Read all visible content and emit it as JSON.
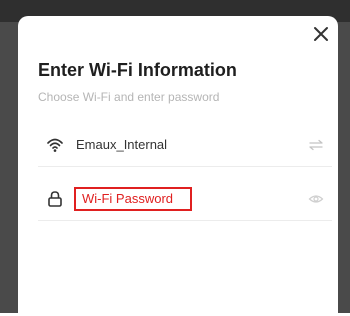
{
  "dialog": {
    "title": "Enter Wi-Fi Information",
    "subtitle": "Choose Wi-Fi and enter password"
  },
  "wifi_row": {
    "icon": "wifi-icon",
    "ssid": "Emaux_Internal",
    "action_icon": "swap-icon"
  },
  "password_row": {
    "icon": "lock-icon",
    "placeholder": "Wi-Fi Password",
    "action_icon": "eye-icon"
  },
  "colors": {
    "highlight": "#e02020",
    "title": "#1f1f1f",
    "subtitle": "#b5b5b5"
  }
}
